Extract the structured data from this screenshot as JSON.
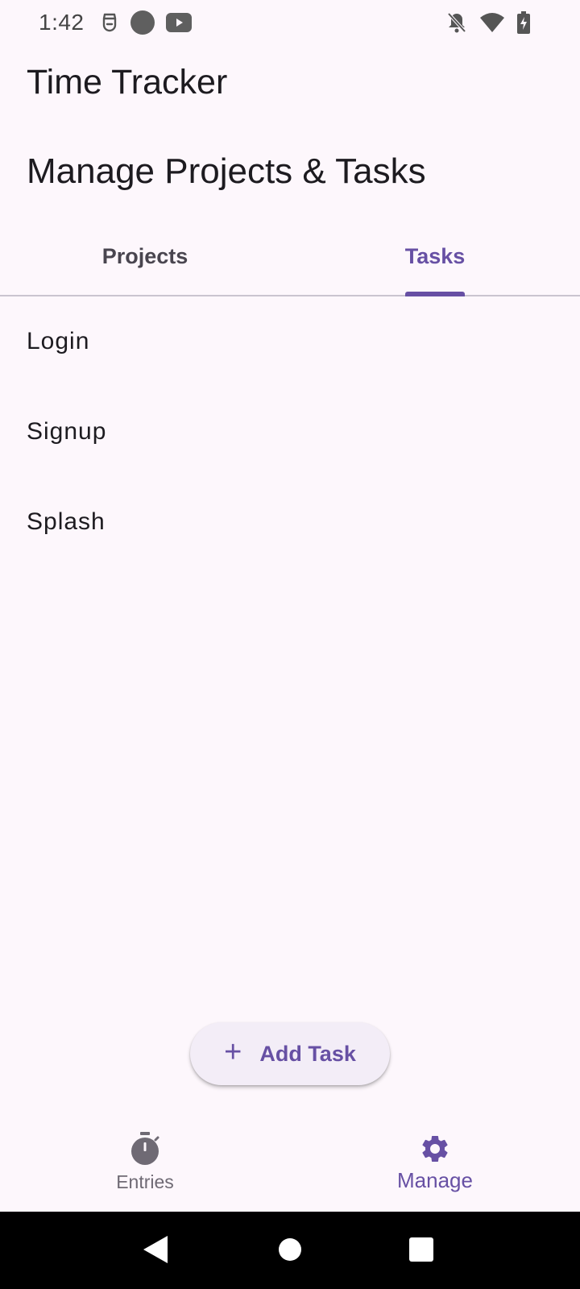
{
  "status_bar": {
    "time": "1:42",
    "left_icons": [
      "assistant-icon",
      "circle-icon",
      "youtube-icon"
    ],
    "right_icons": [
      "bell-off-icon",
      "wifi-icon",
      "battery-charging-icon"
    ]
  },
  "app_bar": {
    "title": "Time Tracker"
  },
  "page": {
    "heading": "Manage Projects & Tasks"
  },
  "tabs": [
    {
      "label": "Projects",
      "selected": false
    },
    {
      "label": "Tasks",
      "selected": true
    }
  ],
  "tasks": [
    {
      "label": "Login"
    },
    {
      "label": "Signup"
    },
    {
      "label": "Splash"
    }
  ],
  "fab": {
    "icon": "plus-icon",
    "label": "Add Task"
  },
  "bottom_nav": [
    {
      "label": "Entries",
      "icon": "timer-icon",
      "selected": false
    },
    {
      "label": "Manage",
      "icon": "gear-icon",
      "selected": true
    }
  ],
  "system_nav": [
    "back-icon",
    "home-icon",
    "recents-icon"
  ],
  "colors": {
    "primary": "#6750a4",
    "background": "#fdf7fc",
    "on_surface": "#1d1b20",
    "on_surface_variant": "#49454f",
    "fab_surface": "#f3edf7",
    "divider": "#cac4d0"
  }
}
